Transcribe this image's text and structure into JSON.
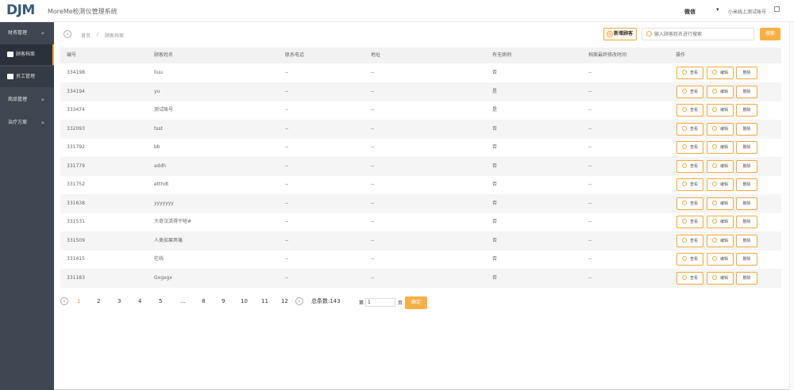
{
  "header": {
    "logo": "DJM",
    "app_title": "MoreMe检测仪管理系统",
    "user_name": "微信",
    "user_caret": "▾",
    "logout_label": "小米线上测试账号"
  },
  "sidebar": {
    "groups": [
      {
        "label": "财务管理",
        "chevron": "»"
      },
      {
        "label": "顾客档案"
      },
      {
        "label": "员工管理"
      },
      {
        "label": "商品管理",
        "chevron": "»"
      },
      {
        "label": "治疗方案",
        "chevron": "»"
      }
    ]
  },
  "breadcrumb": {
    "back_icon": "‹",
    "home": "首页",
    "separator": "/",
    "current": "顾客档案"
  },
  "toolbar": {
    "add_label": "新增顾客",
    "add_icon": "+",
    "search_placeholder": "输入顾客姓名进行搜索",
    "search_label": "搜索"
  },
  "table": {
    "columns": [
      "编号",
      "顾客姓名",
      "联系电话",
      "地址",
      "有无病例",
      "档案最终修改时间",
      "操作"
    ],
    "action_labels": [
      "查看",
      "编辑",
      "删除"
    ],
    "rows": [
      {
        "id": "334198",
        "name": "liuu",
        "phone": "--",
        "address": "--",
        "case": "否",
        "modified": "--"
      },
      {
        "id": "334194",
        "name": "yu",
        "phone": "--",
        "address": "--",
        "case": "是",
        "modified": "--"
      },
      {
        "id": "333474",
        "name": "测试账号",
        "phone": "--",
        "address": "--",
        "case": "是",
        "modified": "--"
      },
      {
        "id": "332093",
        "name": "tsst",
        "phone": "--",
        "address": "--",
        "case": "否",
        "modified": "--"
      },
      {
        "id": "331792",
        "name": "bb",
        "phone": "--",
        "address": "--",
        "case": "否",
        "modified": "--"
      },
      {
        "id": "331779",
        "name": "addh",
        "phone": "--",
        "address": "--",
        "case": "否",
        "modified": "--"
      },
      {
        "id": "331752",
        "name": "etthdt",
        "phone": "--",
        "address": "--",
        "case": "否",
        "modified": "--"
      },
      {
        "id": "331638",
        "name": "yyyyyyy",
        "phone": "--",
        "address": "--",
        "case": "否",
        "modified": "--"
      },
      {
        "id": "331531",
        "name": "大奇汉活得干啥#",
        "phone": "--",
        "address": "--",
        "case": "否",
        "modified": "--"
      },
      {
        "id": "331509",
        "name": "人类如果疼痛",
        "phone": "--",
        "address": "--",
        "case": "否",
        "modified": "--"
      },
      {
        "id": "331415",
        "name": "在线",
        "phone": "--",
        "address": "--",
        "case": "否",
        "modified": "--"
      },
      {
        "id": "331183",
        "name": "Gxgxgx",
        "phone": "--",
        "address": "--",
        "case": "否",
        "modified": "--"
      }
    ]
  },
  "pagination": {
    "prev_icon": "‹",
    "next_icon": "›",
    "pages": [
      "1",
      "2",
      "3",
      "4",
      "5",
      "...",
      "8",
      "9",
      "10",
      "11",
      "12"
    ],
    "current": "1",
    "total": "总条数:143",
    "goto_label": "第",
    "goto_value": "1",
    "goto_unit": "页",
    "goto_button": "确定"
  },
  "colors": {
    "accent": "#f3a93c",
    "sidebar_bg": "#3f4652",
    "logo": "#3a5b7c"
  }
}
